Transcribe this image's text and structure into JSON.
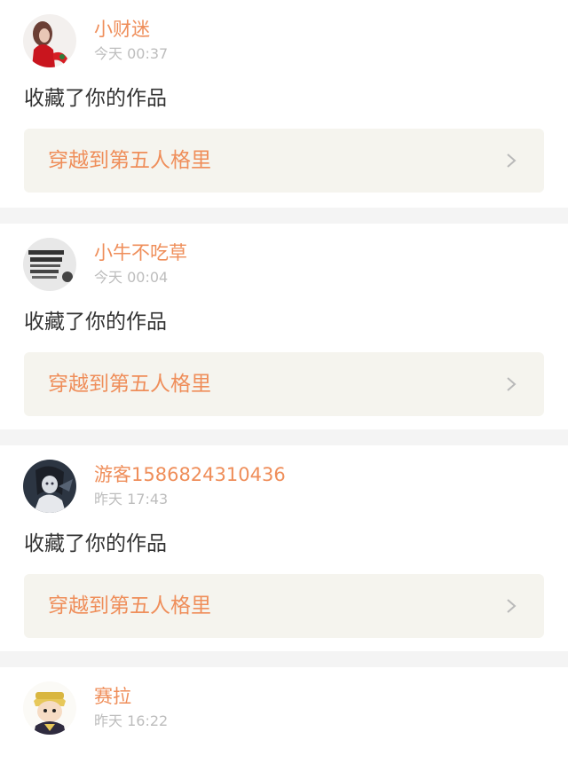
{
  "notifications": [
    {
      "avatar_icon": "avatar-girl-red-dress-icon",
      "username": "小财迷",
      "time": "今天 00:37",
      "action": "收藏了你的作品",
      "work_title": "穿越到第五人格里"
    },
    {
      "avatar_icon": "avatar-text-image-icon",
      "username": "小牛不吃草",
      "time": "今天 00:04",
      "action": "收藏了你的作品",
      "work_title": "穿越到第五人格里"
    },
    {
      "avatar_icon": "avatar-anime-dark-icon",
      "username": "游客1586824310436",
      "time": "昨天 17:43",
      "action": "收藏了你的作品",
      "work_title": "穿越到第五人格里"
    },
    {
      "avatar_icon": "avatar-anime-cartoon-icon",
      "username": "赛拉",
      "time": "昨天 16:22"
    }
  ],
  "colors": {
    "username": "#ef8e5a",
    "time": "#bdbdbd",
    "action": "#333333",
    "link_background": "#f5f4ee",
    "page_background": "#f4f4f4"
  }
}
